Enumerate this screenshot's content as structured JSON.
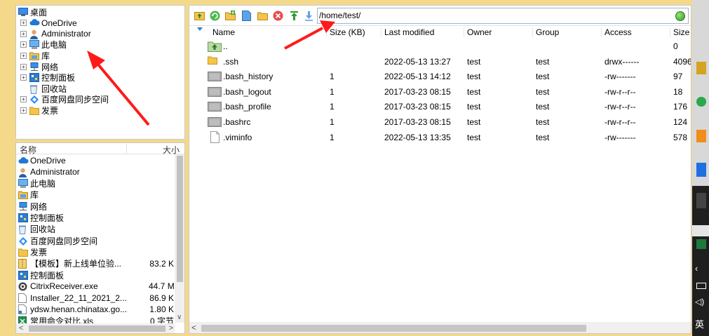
{
  "tree": {
    "items": [
      {
        "label": "桌面",
        "icon": "desktop-icon",
        "expand": ""
      },
      {
        "label": "OneDrive",
        "icon": "cloud-icon",
        "expand": "+"
      },
      {
        "label": "Administrator",
        "icon": "user-icon",
        "expand": "+"
      },
      {
        "label": "此电脑",
        "icon": "computer-icon",
        "expand": "+"
      },
      {
        "label": "库",
        "icon": "library-icon",
        "expand": "+"
      },
      {
        "label": "网络",
        "icon": "network-icon",
        "expand": "+"
      },
      {
        "label": "控制面板",
        "icon": "control-panel-icon",
        "expand": "+"
      },
      {
        "label": "回收站",
        "icon": "recycle-bin-icon",
        "expand": ""
      },
      {
        "label": "百度网盘同步空间",
        "icon": "baidu-sync-icon",
        "expand": "+"
      },
      {
        "label": "发票",
        "icon": "folder-icon",
        "expand": "+"
      }
    ]
  },
  "local_list": {
    "header_name": "名称",
    "header_size": "大小",
    "rows": [
      {
        "name": "OneDrive",
        "size": "",
        "icon": "cloud-icon"
      },
      {
        "name": "Administrator",
        "size": "",
        "icon": "user-icon"
      },
      {
        "name": "此电脑",
        "size": "",
        "icon": "computer-icon"
      },
      {
        "name": "库",
        "size": "",
        "icon": "library-icon"
      },
      {
        "name": "网络",
        "size": "",
        "icon": "network-icon"
      },
      {
        "name": "控制面板",
        "size": "",
        "icon": "control-panel-icon"
      },
      {
        "name": "回收站",
        "size": "",
        "icon": "recycle-bin-icon"
      },
      {
        "name": "百度网盘同步空间",
        "size": "",
        "icon": "baidu-sync-icon"
      },
      {
        "name": "发票",
        "size": "",
        "icon": "folder-icon"
      },
      {
        "name": "【模板】新上线单位验...",
        "size": "83.2 K",
        "icon": "zip-icon"
      },
      {
        "name": "控制面板",
        "size": "",
        "icon": "control-panel-icon"
      },
      {
        "name": "CitrixReceiver.exe",
        "size": "44.7 M",
        "icon": "citrix-icon"
      },
      {
        "name": "Installer_22_11_2021_2...",
        "size": "86.9 K",
        "icon": "file-icon"
      },
      {
        "name": "ydsw.henan.chinatax.go...",
        "size": "1.80 K",
        "icon": "shortcut-icon"
      },
      {
        "name": "常用命令对比.xls",
        "size": "0 字节",
        "icon": "excel-icon"
      }
    ]
  },
  "remote": {
    "path": "/home/test/",
    "columns": [
      "Name",
      "Size (KB)",
      "Last modified",
      "Owner",
      "Group",
      "Access",
      "Size"
    ],
    "rows": [
      {
        "name": "..",
        "size_kb": "",
        "modified": "",
        "owner": "",
        "group": "",
        "access": "",
        "size": "0",
        "icon": "parent-dir-icon"
      },
      {
        "name": ".ssh",
        "size_kb": "",
        "modified": "2022-05-13 13:27",
        "owner": "test",
        "group": "test",
        "access": "drwx------",
        "size": "4096",
        "icon": "folder-icon"
      },
      {
        "name": ".bash_history",
        "size_kb": "1",
        "modified": "2022-05-13 14:12",
        "owner": "test",
        "group": "test",
        "access": "-rw-------",
        "size": "97",
        "icon": "hidden-file-icon"
      },
      {
        "name": ".bash_logout",
        "size_kb": "1",
        "modified": "2017-03-23 08:15",
        "owner": "test",
        "group": "test",
        "access": "-rw-r--r--",
        "size": "18",
        "icon": "hidden-file-icon"
      },
      {
        "name": ".bash_profile",
        "size_kb": "1",
        "modified": "2017-03-23 08:15",
        "owner": "test",
        "group": "test",
        "access": "-rw-r--r--",
        "size": "176",
        "icon": "hidden-file-icon"
      },
      {
        "name": ".bashrc",
        "size_kb": "1",
        "modified": "2017-03-23 08:15",
        "owner": "test",
        "group": "test",
        "access": "-rw-r--r--",
        "size": "124",
        "icon": "hidden-file-icon"
      },
      {
        "name": ".viminfo",
        "size_kb": "1",
        "modified": "2022-05-13 13:35",
        "owner": "test",
        "group": "test",
        "access": "-rw-------",
        "size": "578",
        "icon": "document-icon"
      }
    ]
  },
  "toolbar": {
    "buttons": [
      "parent-folder-icon",
      "refresh-icon",
      "new-folder-icon",
      "new-file-icon",
      "open-folder-icon",
      "delete-icon",
      "upload-icon",
      "download-icon"
    ]
  },
  "taskbar": {
    "ime": "英"
  },
  "colors": {
    "frame": "#f5d98a",
    "accent": "#2f7fd8",
    "annotation": "#ff1a1a"
  }
}
